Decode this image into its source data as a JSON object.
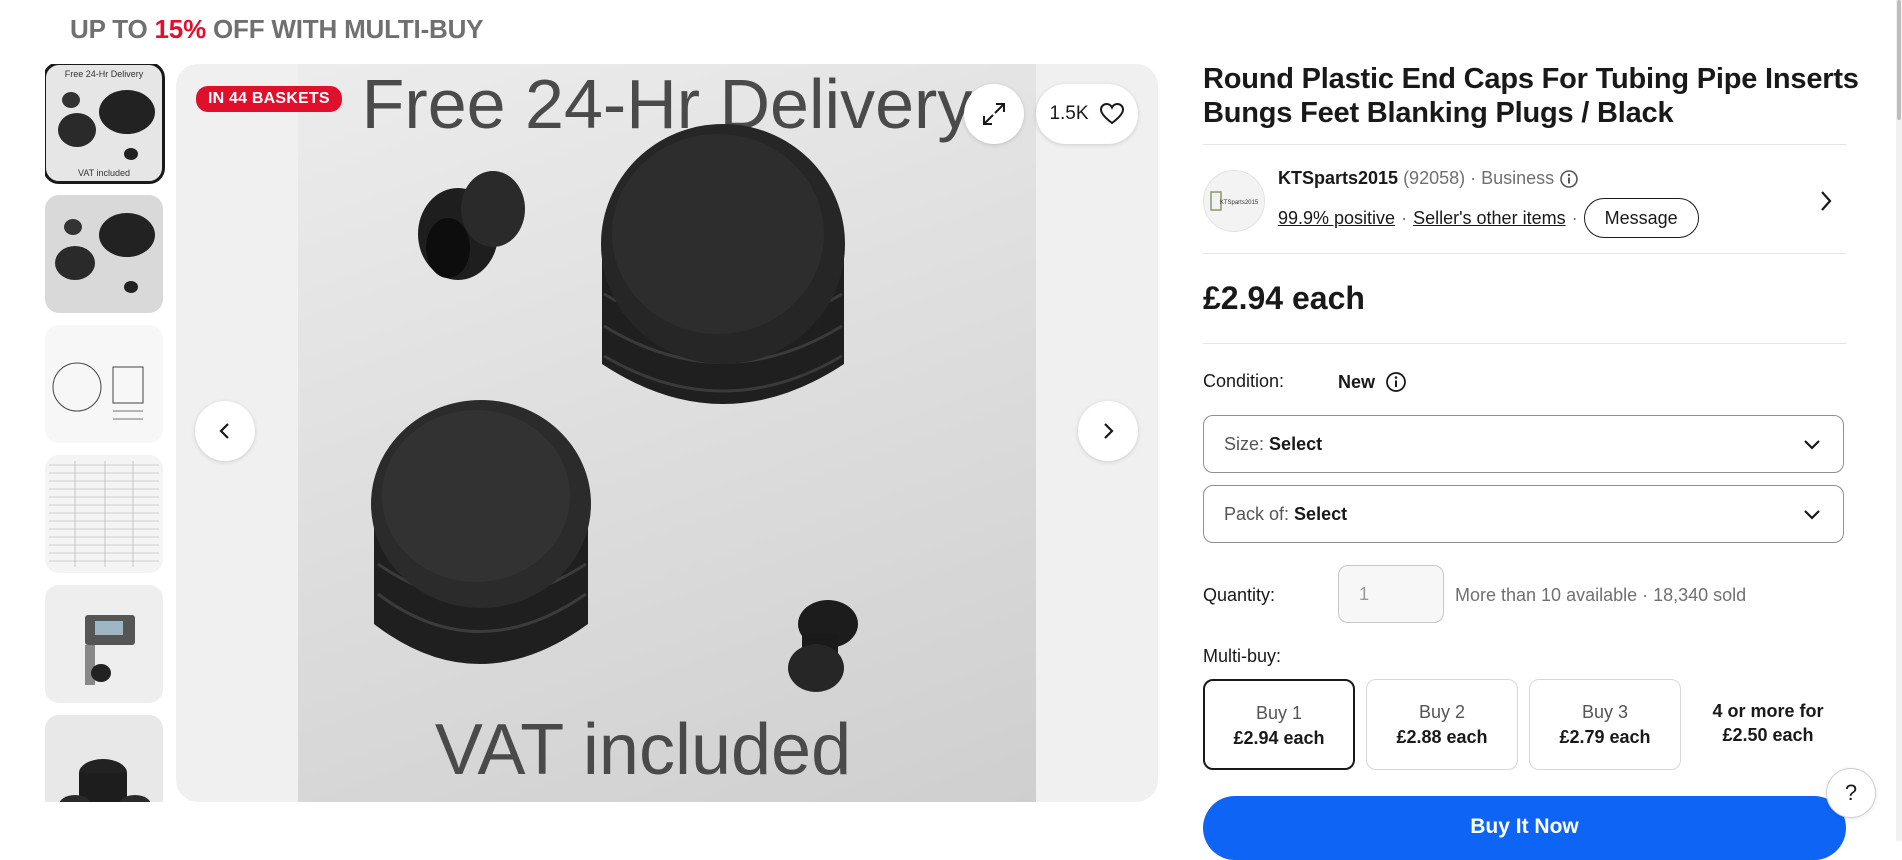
{
  "promo": {
    "prefix": "UP TO ",
    "highlight": "15%",
    "suffix": " OFF WITH MULTI-BUY"
  },
  "gallery": {
    "badge": "IN 44 BASKETS",
    "watch_count": "1.5K",
    "image_text_top": "Free 24-Hr Delivery",
    "image_text_bottom": "VAT included"
  },
  "thumbs": {
    "thumb1_top": "Free 24-Hr Delivery",
    "thumb1_bottom": "VAT included"
  },
  "product": {
    "title": "Round Plastic End Caps For Tubing Pipe Inserts Bungs Feet Blanking Plugs / Black"
  },
  "seller": {
    "logo_text": "KTSparts2015",
    "name": "KTSparts2015",
    "feedback_count": "(92058)",
    "sep": "·",
    "type": "Business",
    "positive": "99.9% positive",
    "other_items": "Seller's other items",
    "message_label": "Message"
  },
  "price": "£2.94 each",
  "condition": {
    "label": "Condition:",
    "value": "New"
  },
  "size_select": {
    "label": "Size:",
    "value": "Select"
  },
  "pack_select": {
    "label": "Pack of:",
    "value": "Select"
  },
  "quantity": {
    "label": "Quantity:",
    "value": "1",
    "availability": "More than 10 available · 18,340 sold"
  },
  "multibuy": {
    "label": "Multi-buy:",
    "options": [
      {
        "qty": "Buy 1",
        "price": "£2.94 each"
      },
      {
        "qty": "Buy 2",
        "price": "£2.88 each"
      },
      {
        "qty": "Buy 3",
        "price": "£2.79 each"
      }
    ],
    "more_line1": "4 or more for",
    "more_line2": "£2.50 each"
  },
  "buy_now": "Buy It Now",
  "help": "?",
  "colors": {
    "accent_red": "#e0102c",
    "primary_blue": "#0e64f5",
    "text": "#191919",
    "muted": "#707070"
  },
  "icons": [
    "expand-icon",
    "heart-icon",
    "chevron-left-icon",
    "chevron-right-icon",
    "info-icon",
    "chevron-down-icon"
  ]
}
